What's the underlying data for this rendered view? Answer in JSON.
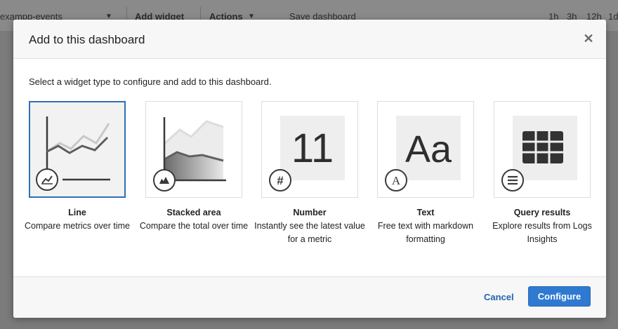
{
  "background_toolbar": {
    "dashboard_select": "exampp-events",
    "add_widget": "Add widget",
    "actions": "Actions",
    "save_dashboard": "Save dashboard",
    "time_ranges": [
      "1h",
      "3h",
      "12h",
      "1d"
    ]
  },
  "modal": {
    "title": "Add to this dashboard",
    "subtitle": "Select a widget type to configure and add to this dashboard.",
    "close_icon": "close-icon",
    "widgets": [
      {
        "name": "Line",
        "description": "Compare metrics over time",
        "icon": "line-chart-icon",
        "selected": true
      },
      {
        "name": "Stacked area",
        "description": "Compare the total over time",
        "icon": "area-chart-icon",
        "selected": false
      },
      {
        "name": "Number",
        "description": "Instantly see the latest value for a metric",
        "icon": "hash-icon",
        "preview_text": "11",
        "selected": false
      },
      {
        "name": "Text",
        "description": "Free text with markdown formatting",
        "icon": "text-icon",
        "preview_text": "Aa",
        "selected": false
      },
      {
        "name": "Query results",
        "description": "Explore results from Logs Insights",
        "icon": "list-icon",
        "selected": false
      }
    ],
    "footer": {
      "cancel_label": "Cancel",
      "configure_label": "Configure"
    }
  },
  "colors": {
    "accent": "#2f7ad0",
    "selected_border": "#2f6fba",
    "link": "#2463b0"
  }
}
